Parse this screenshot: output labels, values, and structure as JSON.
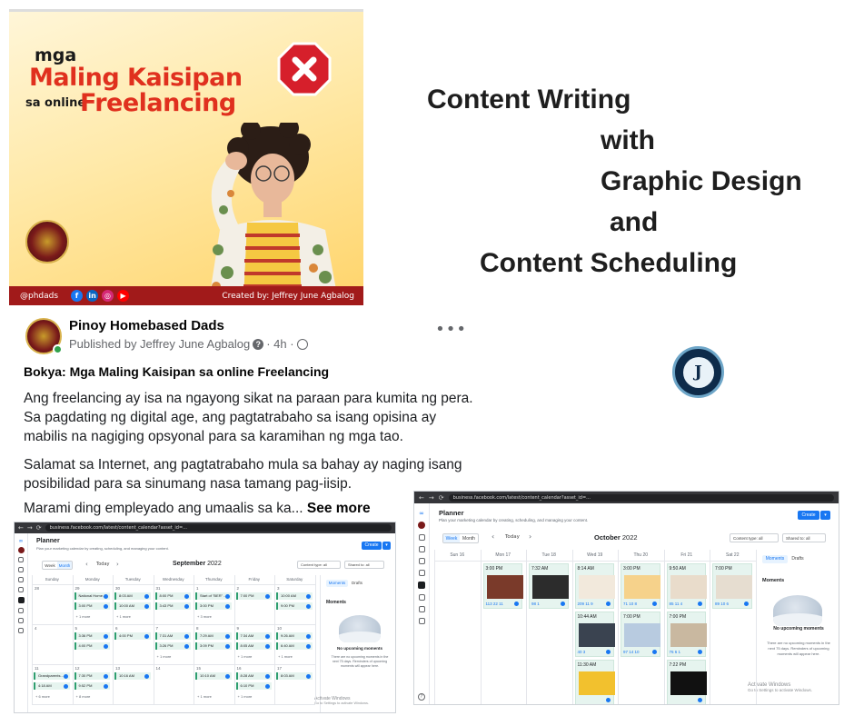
{
  "promo": {
    "mga": "mga",
    "title_line1": "Maling Kaisipan",
    "sa_online": "sa online",
    "title_line2": "Freelancing",
    "handle": "@phdads",
    "credit": "Created by: Jeffrey June Agbalog",
    "social_icons": [
      "facebook-icon",
      "linkedin-icon",
      "instagram-icon",
      "youtube-icon"
    ],
    "colors": {
      "title_red": "#e0301e",
      "footer": "#a11a1a"
    }
  },
  "headline": {
    "line1": "Content Writing",
    "line2": "with",
    "line3": "Graphic Design",
    "line4": "and",
    "line5": "Content  Scheduling"
  },
  "post": {
    "page_name": "Pinoy Homebased Dads",
    "published_by": "Published by Jeffrey June Agbalog",
    "time": "· 4h ·",
    "title": "Bokya: Mga Maling Kaisipan sa online Freelancing",
    "para1": "Ang freelancing ay isa na ngayong sikat na paraan para kumita ng pera. Sa pagdating ng digital age, ang pagtatrabaho sa isang opisina ay mabilis na nagiging opsyonal para sa karamihan ng mga tao.",
    "para2": "Salamat sa Internet, ang pagtatrabaho mula sa bahay ay naging isang posibilidad para sa sinumang nasa tamang pag-iisip.",
    "para3": "Marami ding empleyado ang umaalis sa ka...",
    "see_more": "See more",
    "more_icon": "•••"
  },
  "september": {
    "url": "business.facebook.com/latest/content_calendar?asset_id=...",
    "title": "Planner",
    "subtitle": "Plan your marketing calendar by creating, scheduling, and managing your content.",
    "create": "Create",
    "week": "Week",
    "month": "Month",
    "today": "Today",
    "month_name": "September",
    "year": "2022",
    "content_type": "Content type: all",
    "shared_to": "Shared to: all",
    "days": [
      "Sunday",
      "Monday",
      "Tuesday",
      "Wednesday",
      "Thursday",
      "Friday",
      "Saturday"
    ],
    "week_numbers": [
      [
        "28",
        "29",
        "30",
        "31",
        "1",
        "2",
        "3"
      ],
      [
        "4",
        "5",
        "6",
        "7",
        "8",
        "9",
        "10"
      ],
      [
        "11",
        "12",
        "13",
        "14",
        "15",
        "16",
        "17"
      ]
    ],
    "events": [
      {
        "label": "National Home..."
      },
      {
        "label": "8:03 AM"
      },
      {
        "label": "8:00 PM"
      },
      {
        "label": "Start of \"BER\" ..."
      },
      {
        "label": "7:00 PM"
      },
      {
        "label": "10:00 AM"
      },
      {
        "label": "3:00 PM"
      },
      {
        "label": "10:00 AM"
      },
      {
        "label": "3:43 PM"
      },
      {
        "label": "3:00 PM"
      },
      {
        "label": "9:00 PM"
      },
      {
        "label": "3:36 PM"
      },
      {
        "label": "4:00 PM"
      },
      {
        "label": "7:31 AM"
      },
      {
        "label": "7:29 AM"
      },
      {
        "label": "7:34 AM"
      },
      {
        "label": "9:26 AM"
      },
      {
        "label": "4:00 PM"
      },
      {
        "label": "3:26 PM"
      },
      {
        "label": "3:09 PM"
      },
      {
        "label": "8:05 AM"
      },
      {
        "label": "6:40 AM"
      },
      {
        "label": "Grandparents..."
      },
      {
        "label": "7:30 PM"
      },
      {
        "label": "10:16 AM"
      },
      {
        "label": "10:10 AM"
      },
      {
        "label": "8:28 AM"
      },
      {
        "label": "8:03 AM"
      },
      {
        "label": "4:18 AM"
      },
      {
        "label": "9:52 PM"
      },
      {
        "label": "6:10 PM"
      }
    ],
    "more_labels": [
      "+ 1 more",
      "+ 1 more",
      "+ 3 more",
      "+ 1 more",
      "+ 1 more",
      "+ 1 more",
      "+ 6 more",
      "+ 8 more",
      "+ 1 more",
      "+ 1 more"
    ],
    "moments_tab": "Moments",
    "drafts_tab": "Drafts",
    "moments_head": "Moments",
    "no_moments": "No upcoming moments",
    "no_moments_text": "There are no upcoming moments in the next 75 days. Reminders of upcoming moments will appear here.",
    "activate1": "Activate Windows",
    "activate2": "Go to Settings to activate Windows."
  },
  "october": {
    "url": "business.facebook.com/latest/content_calendar?asset_id=...",
    "title": "Planner",
    "subtitle": "Plan your marketing calendar by creating, scheduling, and managing your content.",
    "create": "Create",
    "week": "Week",
    "month": "Month",
    "today": "Today",
    "month_name": "October",
    "year": "2022",
    "content_type": "Content type: all",
    "shared_to": "Shared to: all",
    "days": [
      "Sun 16",
      "Mon 17",
      "Tue 18",
      "Wed 19",
      "Thu 20",
      "Fri 21",
      "Sat 22"
    ],
    "cards": [
      {
        "time": "3:00 PM",
        "stats": "113  22  11"
      },
      {
        "time": "7:32 AM",
        "stats": "98  1"
      },
      {
        "time": "8:14 AM",
        "stats": "209  11  9"
      },
      {
        "time": "3:00 PM",
        "stats": "71  10  8"
      },
      {
        "time": "9:50 AM",
        "stats": "85  11  4"
      },
      {
        "time": "7:00 PM",
        "stats": "89  10  6"
      },
      {
        "time": "10:44 AM",
        "stats": "40  3"
      },
      {
        "time": "7:00 PM",
        "stats": "97  14  10"
      },
      {
        "time": "7:00 PM",
        "stats": "76  6  1"
      },
      {
        "time": "11:30 AM",
        "stats": ""
      },
      {
        "time": "7:22 PM",
        "stats": ""
      }
    ],
    "moments_tab": "Moments",
    "drafts_tab": "Drafts",
    "moments_head": "Moments",
    "no_moments": "No upcoming moments",
    "no_moments_text": "There are no upcoming moments in the next 75 days. Reminders of upcoming moments will appear here.",
    "activate1": "Activate Windows",
    "activate2": "Go to Settings to activate Windows."
  }
}
